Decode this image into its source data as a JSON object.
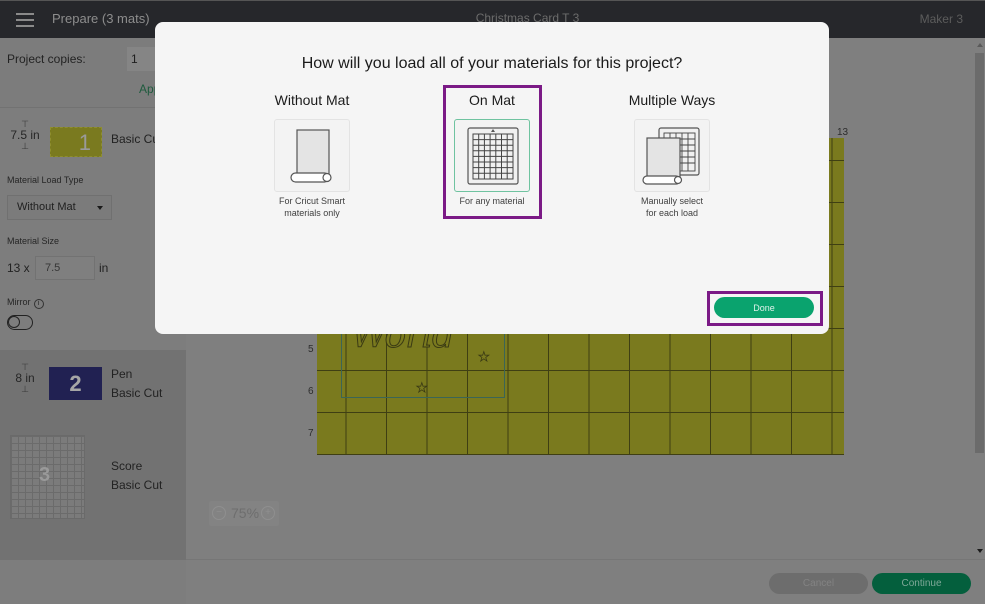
{
  "header": {
    "prepare_label": "Prepare (3 mats)",
    "project_title": "Christmas Card T 3",
    "machine_name": "Maker 3"
  },
  "sidebar": {
    "copies_label": "Project copies:",
    "copies_value": "1",
    "apply_label": "Apply",
    "mats": [
      {
        "number": "1",
        "height_label": "7.5 in",
        "name_line1": "Basic Cut",
        "color": "#7a7a1e"
      },
      {
        "number": "2",
        "height_label": "8 in",
        "name_line1": "Pen",
        "name_line2": "Basic Cut",
        "color": "#212152"
      },
      {
        "number": "3",
        "name_line1": "Score",
        "name_line2": "Basic Cut"
      }
    ],
    "material_load_type_label": "Material Load Type",
    "material_load_type_value": "Without Mat",
    "material_size_label": "Material Size",
    "material_width": "13 x",
    "material_height_value": "7.5",
    "material_unit": "in",
    "mirror_label": "Mirror",
    "mirror_on": false
  },
  "canvas": {
    "ruler_top_right": "13",
    "ruler_left": [
      "5",
      "6",
      "7"
    ],
    "design_text": "World",
    "zoom_level": "75%",
    "zoom_out_icon": "minus-circle",
    "zoom_in_icon": "plus-circle"
  },
  "footer": {
    "cancel_label": "Cancel",
    "continue_label": "Continue"
  },
  "modal": {
    "title": "How will you load all of your materials for this project?",
    "options": [
      {
        "title": "Without Mat",
        "desc_line1": "For Cricut Smart",
        "desc_line2": "materials only",
        "icon": "roll-icon",
        "selected": false
      },
      {
        "title": "On Mat",
        "desc_line1": "For any material",
        "desc_line2": "",
        "icon": "mat-grid-icon",
        "selected": true
      },
      {
        "title": "Multiple Ways",
        "desc_line1": "Manually select",
        "desc_line2": "for each load",
        "icon": "roll-and-mat-icon",
        "selected": false
      }
    ],
    "done_label": "Done",
    "accent_color": "#0aa36e",
    "highlight_color": "#7b1a86"
  }
}
